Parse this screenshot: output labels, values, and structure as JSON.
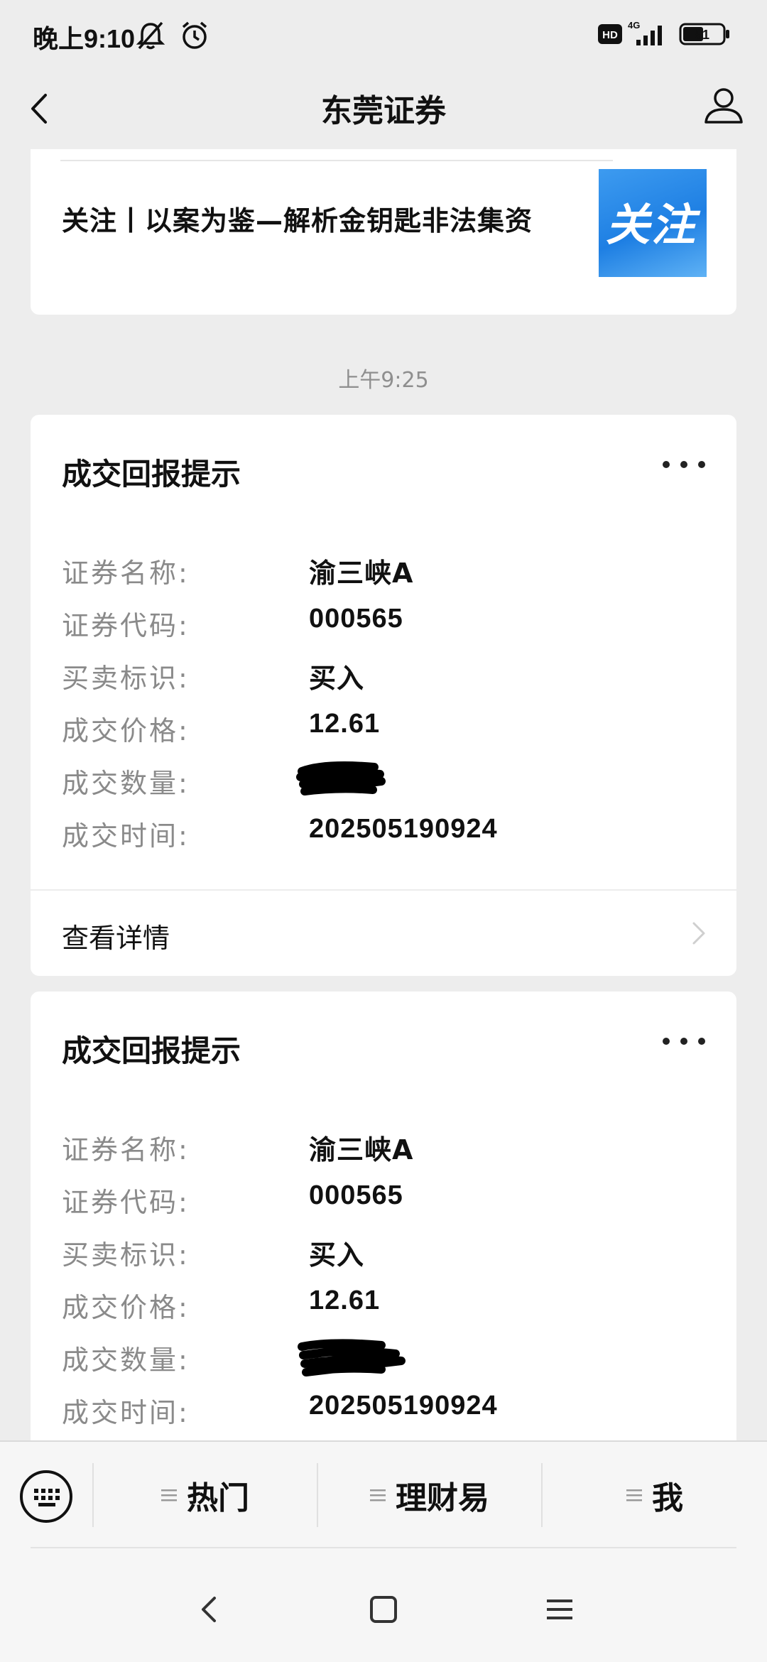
{
  "status_bar": {
    "time": "晚上9:10",
    "network": "4G",
    "hd": "HD",
    "battery": "51"
  },
  "header": {
    "title": "东莞证券"
  },
  "article": {
    "title": "关注丨以案为鉴—解析金钥匙非法集资",
    "thumbnail_text": "关注"
  },
  "timestamp": "上午9:25",
  "trade_cards": [
    {
      "title": "成交回报提示",
      "fields": [
        {
          "label": "证券名称:",
          "value": "渝三峡A"
        },
        {
          "label": "证券代码:",
          "value": "000565"
        },
        {
          "label": "买卖标识:",
          "value": "买入"
        },
        {
          "label": "成交价格:",
          "value": "12.61"
        },
        {
          "label": "成交数量:",
          "value": ""
        },
        {
          "label": "成交时间:",
          "value": "202505190924"
        }
      ],
      "detail_link": "查看详情"
    },
    {
      "title": "成交回报提示",
      "fields": [
        {
          "label": "证券名称:",
          "value": "渝三峡A"
        },
        {
          "label": "证券代码:",
          "value": "000565"
        },
        {
          "label": "买卖标识:",
          "value": "买入"
        },
        {
          "label": "成交价格:",
          "value": "12.61"
        },
        {
          "label": "成交数量:",
          "value": ""
        },
        {
          "label": "成交时间:",
          "value": "202505190924"
        }
      ]
    }
  ],
  "menu": {
    "items": [
      {
        "label": "热门"
      },
      {
        "label": "理财易"
      },
      {
        "label": "我"
      }
    ]
  },
  "icons": {
    "status": [
      "mute-icon",
      "alarm-icon",
      "signal-icon",
      "battery-icon"
    ],
    "header": [
      "back-icon",
      "profile-icon"
    ],
    "menu": [
      "keyboard-icon",
      "hamburger-icon"
    ],
    "system": [
      "nav-back-icon",
      "nav-home-icon",
      "nav-menu-icon"
    ]
  }
}
